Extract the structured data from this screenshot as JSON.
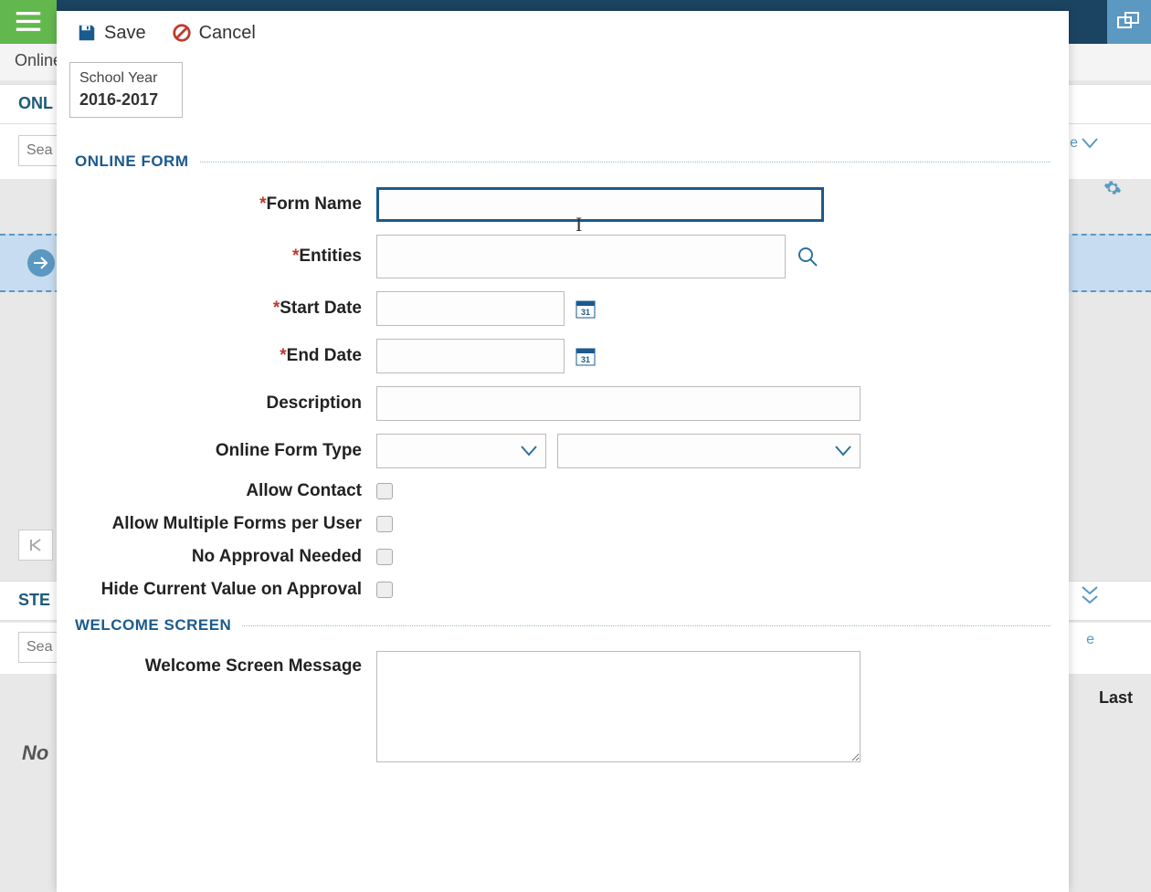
{
  "background": {
    "breadcrumb": "Online",
    "heading1": "ONL",
    "search_placeholder": "Sea",
    "right_drop": "e",
    "heading2": "STE",
    "search2_placeholder": "Sea",
    "right_drop2": "e",
    "col_label": "Last",
    "no_text": "No"
  },
  "toolbar": {
    "save_label": "Save",
    "cancel_label": "Cancel"
  },
  "yearbox": {
    "label": "School Year",
    "value": "2016-2017"
  },
  "sections": {
    "online_form": "ONLINE FORM",
    "welcome_screen": "WELCOME SCREEN"
  },
  "fields": {
    "form_name": {
      "label": "Form Name",
      "value": ""
    },
    "entities": {
      "label": "Entities",
      "value": ""
    },
    "start_date": {
      "label": "Start Date",
      "value": ""
    },
    "end_date": {
      "label": "End Date",
      "value": ""
    },
    "description": {
      "label": "Description",
      "value": ""
    },
    "form_type": {
      "label": "Online Form Type",
      "value1": "",
      "value2": ""
    },
    "allow_contact": {
      "label": "Allow Contact"
    },
    "allow_multiple": {
      "label": "Allow Multiple Forms per User"
    },
    "no_approval": {
      "label": "No Approval Needed"
    },
    "hide_current": {
      "label": "Hide Current Value on Approval"
    },
    "welcome_msg": {
      "label": "Welcome Screen Message",
      "value": ""
    }
  }
}
